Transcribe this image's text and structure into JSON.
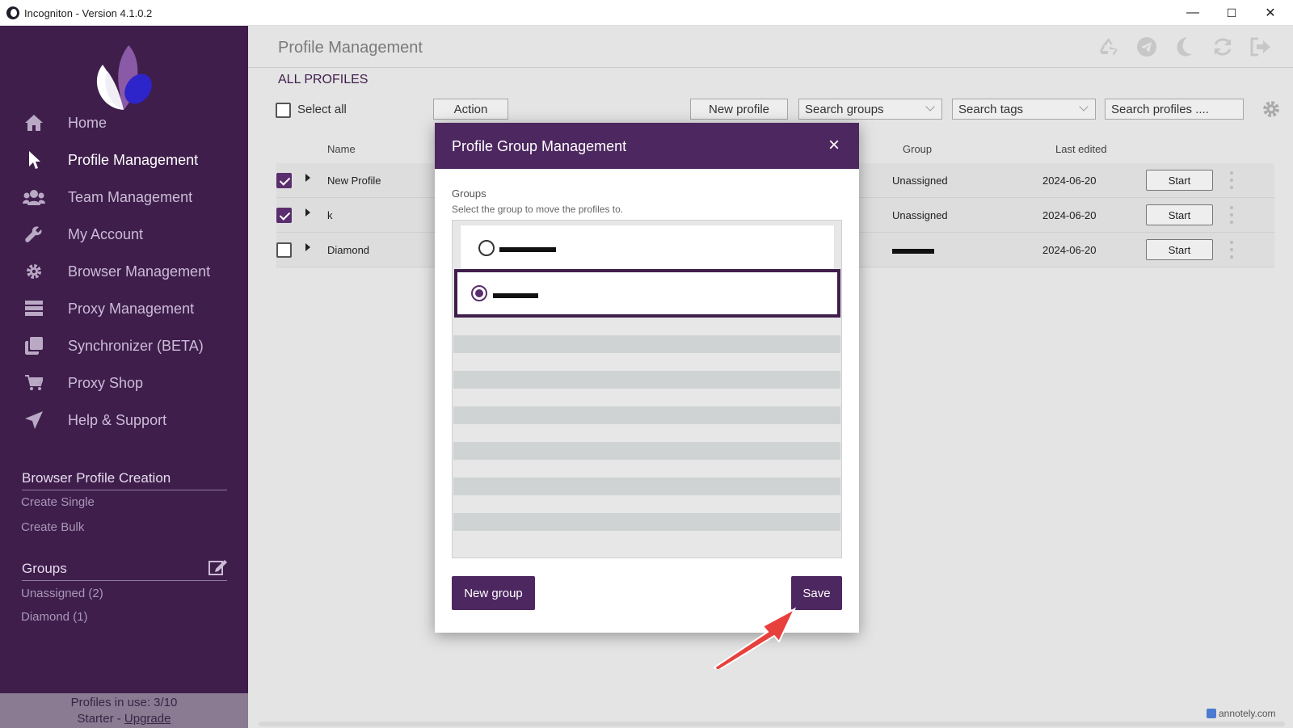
{
  "window": {
    "title": "Incogniton - Version 4.1.0.2",
    "minimize": "—",
    "maximize": "☐",
    "close": "✕"
  },
  "sidebar": {
    "nav": [
      {
        "label": "Home",
        "icon": "home-icon"
      },
      {
        "label": "Profile Management",
        "icon": "cursor-icon",
        "active": true
      },
      {
        "label": "Team Management",
        "icon": "team-icon"
      },
      {
        "label": "My Account",
        "icon": "wrench-icon"
      },
      {
        "label": "Browser Management",
        "icon": "gear-icon"
      },
      {
        "label": "Proxy Management",
        "icon": "server-icon"
      },
      {
        "label": "Synchronizer (BETA)",
        "icon": "copy-icon"
      },
      {
        "label": "Proxy Shop",
        "icon": "cart-icon"
      },
      {
        "label": "Help & Support",
        "icon": "send-icon"
      }
    ],
    "creation_title": "Browser Profile Creation",
    "create_single": "Create Single",
    "create_bulk": "Create Bulk",
    "groups_title": "Groups",
    "groups": [
      "Unassigned (2)",
      "Diamond (1)"
    ],
    "usage_line1": "Profiles in use:  3/10",
    "usage_plan": "Starter - ",
    "usage_upgrade": "Upgrade"
  },
  "main": {
    "page_title": "Profile Management",
    "section_title": "ALL PROFILES",
    "select_all": "Select all",
    "action": "Action",
    "new_profile": "New profile",
    "search_groups": "Search groups",
    "search_tags": "Search tags",
    "search_profiles": "Search profiles ....",
    "columns": {
      "name": "Name",
      "group": "Group",
      "last_edited": "Last edited"
    },
    "rows": [
      {
        "name": "New Profile",
        "group": "Unassigned",
        "date": "2024-06-20",
        "start": "Start",
        "checked": true
      },
      {
        "name": "k",
        "group": "Unassigned",
        "date": "2024-06-20",
        "start": "Start",
        "checked": true
      },
      {
        "name": "Diamond",
        "group": "",
        "date": "2024-06-20",
        "start": "Start",
        "checked": false
      }
    ]
  },
  "modal": {
    "title": "Profile Group Management",
    "close": "×",
    "groups_label": "Groups",
    "instruction": "Select the group to move the profiles to.",
    "new_group": "New group",
    "save": "Save"
  },
  "watermark": "annotely.com",
  "colors": {
    "sidebar": "#3f1e4c",
    "accent": "#4d2760",
    "arrow": "#e8403d"
  }
}
